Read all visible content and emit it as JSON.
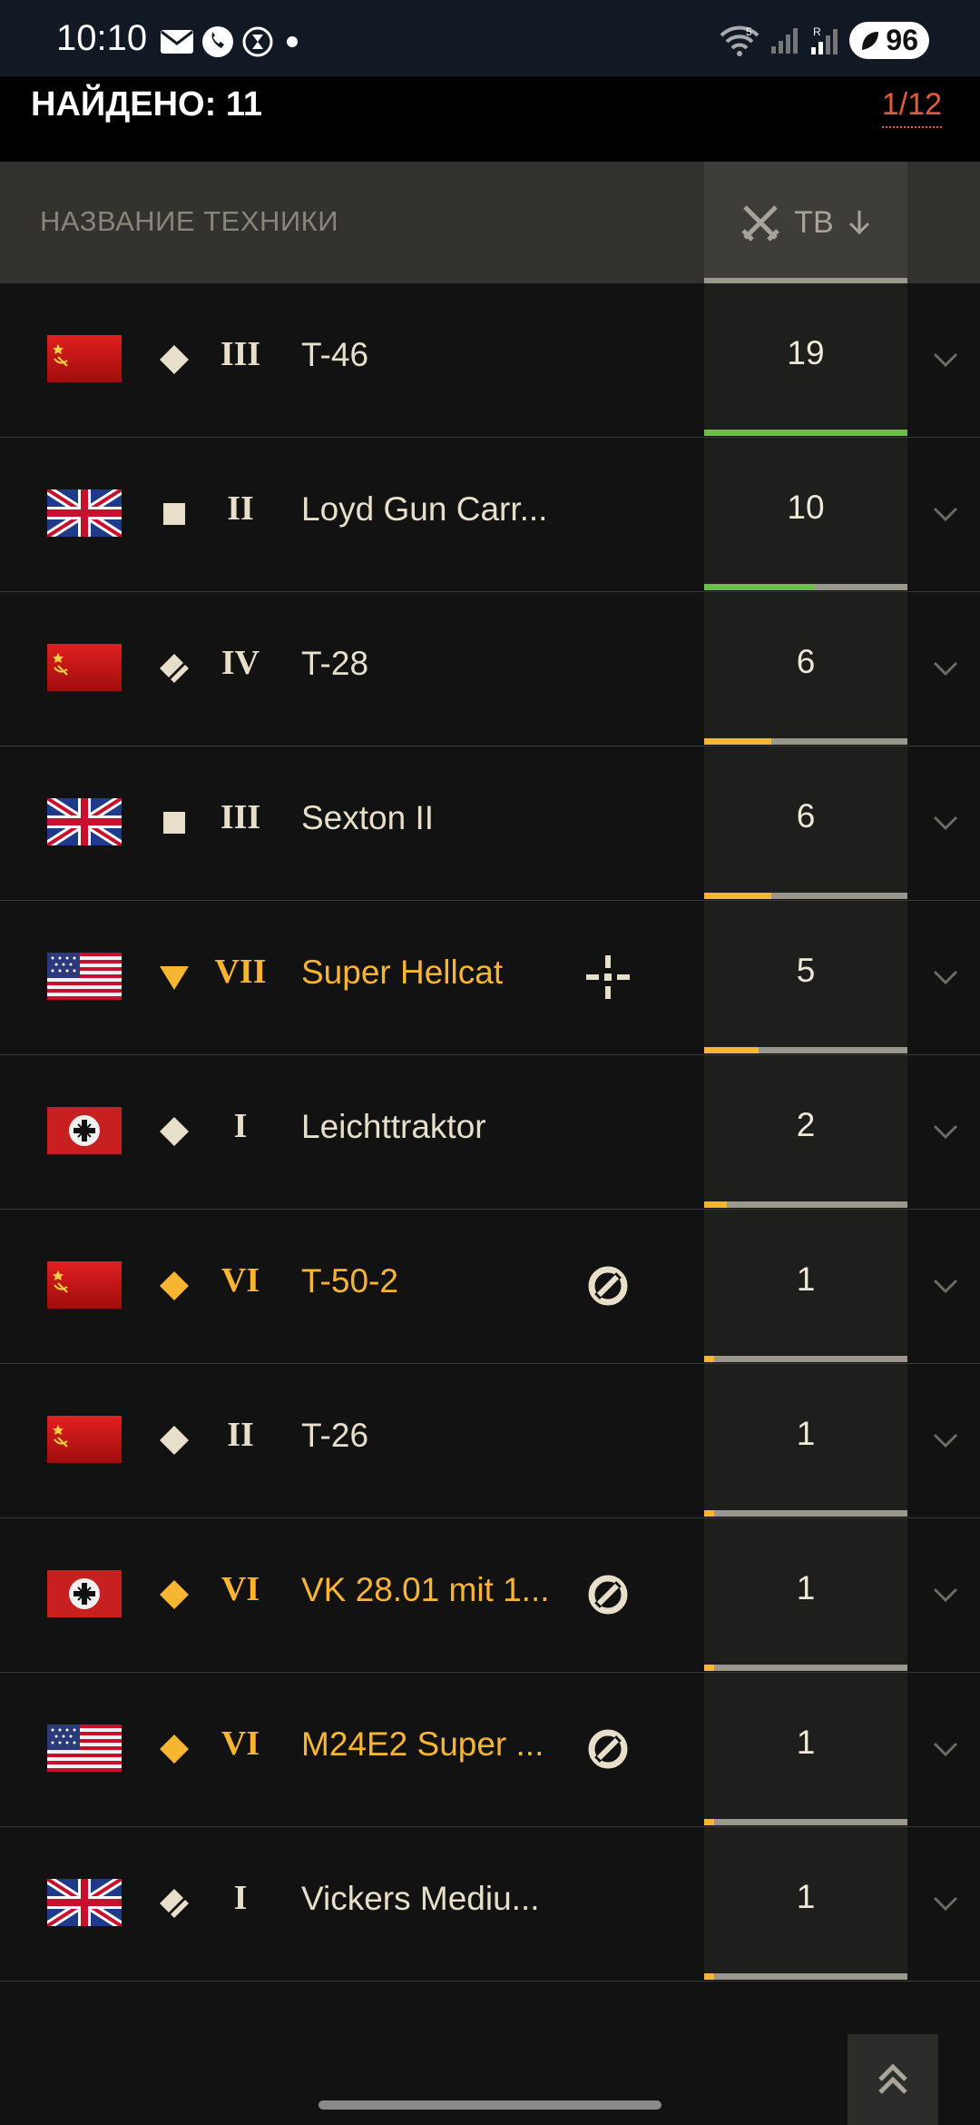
{
  "status_bar": {
    "time": "10:10",
    "battery": "96",
    "network_label": "5",
    "roaming_label": "R"
  },
  "header": {
    "found": "НАЙДЕНО: 11",
    "page": "1/12"
  },
  "table_header": {
    "name_col": "НАЗВАНИЕ ТЕХНИКИ",
    "tb_col": "ТВ"
  },
  "colors": {
    "premium": "#f7b532",
    "normal": "#e7dfc9",
    "bar_green": "#6cc04a",
    "bar_orange": "#f7b532",
    "bar_track": "#9a978d"
  },
  "rows": [
    {
      "flag": "ussr",
      "type": "diamond",
      "tier": "III",
      "name": "T-46",
      "premium": false,
      "special": "",
      "score": "19",
      "bar": 1.0,
      "bar_color": "green"
    },
    {
      "flag": "uk",
      "type": "square",
      "tier": "II",
      "name": "Loyd Gun Carr...",
      "premium": false,
      "special": "",
      "score": "10",
      "bar": 0.54,
      "bar_color": "green"
    },
    {
      "flag": "ussr",
      "type": "split-diamond",
      "tier": "IV",
      "name": "T-28",
      "premium": false,
      "special": "",
      "score": "6",
      "bar": 0.33,
      "bar_color": "orange"
    },
    {
      "flag": "uk",
      "type": "square",
      "tier": "III",
      "name": "Sexton II",
      "premium": false,
      "special": "",
      "score": "6",
      "bar": 0.33,
      "bar_color": "orange"
    },
    {
      "flag": "usa",
      "type": "triangle",
      "tier": "VII",
      "name": "Super Hellcat",
      "premium": true,
      "special": "crosshair",
      "score": "5",
      "bar": 0.27,
      "bar_color": "orange"
    },
    {
      "flag": "germany",
      "type": "diamond",
      "tier": "I",
      "name": "Leichttraktor",
      "premium": false,
      "special": "",
      "score": "2",
      "bar": 0.11,
      "bar_color": "orange"
    },
    {
      "flag": "ussr",
      "type": "diamond",
      "tier": "VI",
      "name": "T-50-2",
      "premium": true,
      "special": "cycle",
      "score": "1",
      "bar": 0.05,
      "bar_color": "orange"
    },
    {
      "flag": "ussr",
      "type": "diamond",
      "tier": "II",
      "name": "T-26",
      "premium": false,
      "special": "",
      "score": "1",
      "bar": 0.05,
      "bar_color": "orange"
    },
    {
      "flag": "germany",
      "type": "diamond",
      "tier": "VI",
      "name": "VK 28.01 mit 1...",
      "premium": true,
      "special": "cycle",
      "score": "1",
      "bar": 0.05,
      "bar_color": "orange"
    },
    {
      "flag": "usa",
      "type": "diamond",
      "tier": "VI",
      "name": "M24E2 Super ...",
      "premium": true,
      "special": "cycle",
      "score": "1",
      "bar": 0.05,
      "bar_color": "orange"
    },
    {
      "flag": "uk",
      "type": "split-diamond",
      "tier": "I",
      "name": "Vickers Mediu...",
      "premium": false,
      "special": "",
      "score": "1",
      "bar": 0.05,
      "bar_color": "orange"
    }
  ]
}
